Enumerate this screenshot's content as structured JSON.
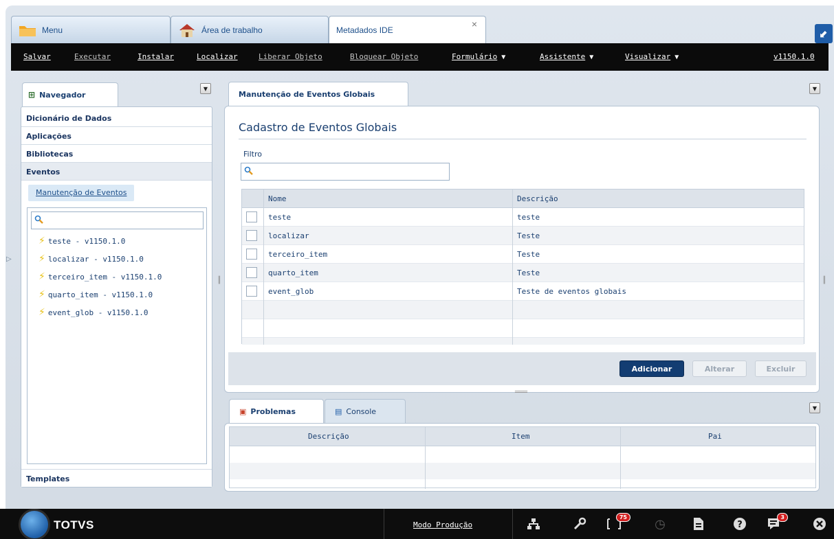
{
  "top_tabs": [
    {
      "label": "Menu"
    },
    {
      "label": "Área de trabalho"
    },
    {
      "label": "Metadados IDE",
      "closable": true,
      "close_glyph": "×"
    }
  ],
  "corner_button": {
    "icon": "collapse-arrow-icon",
    "glyph": "⬋"
  },
  "menubar": {
    "items": [
      {
        "label": "Salvar"
      },
      {
        "label": "Executar"
      },
      {
        "label": "Instalar"
      },
      {
        "label": "Localizar"
      },
      {
        "label": "Liberar Objeto"
      },
      {
        "label": "Bloquear Objeto"
      },
      {
        "label": "Formulário"
      },
      {
        "label": "Assistente"
      },
      {
        "label": "Visualizar"
      }
    ],
    "version": "v1150.1.0"
  },
  "navigator": {
    "tab_label": "Navegador",
    "sections": [
      {
        "label": "Dicionário de Dados"
      },
      {
        "label": "Aplicações"
      },
      {
        "label": "Bibliotecas"
      },
      {
        "label": "Eventos"
      }
    ],
    "link": "Manutenção de Eventos",
    "search_value": "",
    "tree_items": [
      "teste - v1150.1.0",
      "localizar - v1150.1.0",
      "terceiro_item - v1150.1.0",
      "quarto_item - v1150.1.0",
      "event_glob - v1150.1.0"
    ],
    "footer_section": "Templates"
  },
  "main": {
    "tab_label": "Manutenção de Eventos Globais",
    "heading": "Cadastro de Eventos Globais",
    "filter_label": "Filtro",
    "filter_value": "",
    "grid": {
      "columns": [
        "Nome",
        "Descrição"
      ],
      "rows": [
        {
          "nome": "teste",
          "descricao": "teste"
        },
        {
          "nome": "localizar",
          "descricao": "Teste"
        },
        {
          "nome": "terceiro_item",
          "descricao": "Teste"
        },
        {
          "nome": "quarto_item",
          "descricao": "Teste"
        },
        {
          "nome": "event_glob",
          "descricao": "Teste de eventos globais"
        }
      ]
    },
    "buttons": {
      "add": "Adicionar",
      "edit": "Alterar",
      "delete": "Excluir"
    }
  },
  "problems": {
    "tabs": [
      {
        "label": "Problemas"
      },
      {
        "label": "Console"
      }
    ],
    "columns": [
      "Descrição",
      "Item",
      "Pai"
    ]
  },
  "footer": {
    "brand": "TOTVS",
    "mode": "Modo Produção",
    "notifications_count": "75",
    "messages_count": "3"
  },
  "colors": {
    "accent": "#133d72",
    "menubar_bg": "#0b0b0b",
    "badge": "#d21e1e"
  }
}
